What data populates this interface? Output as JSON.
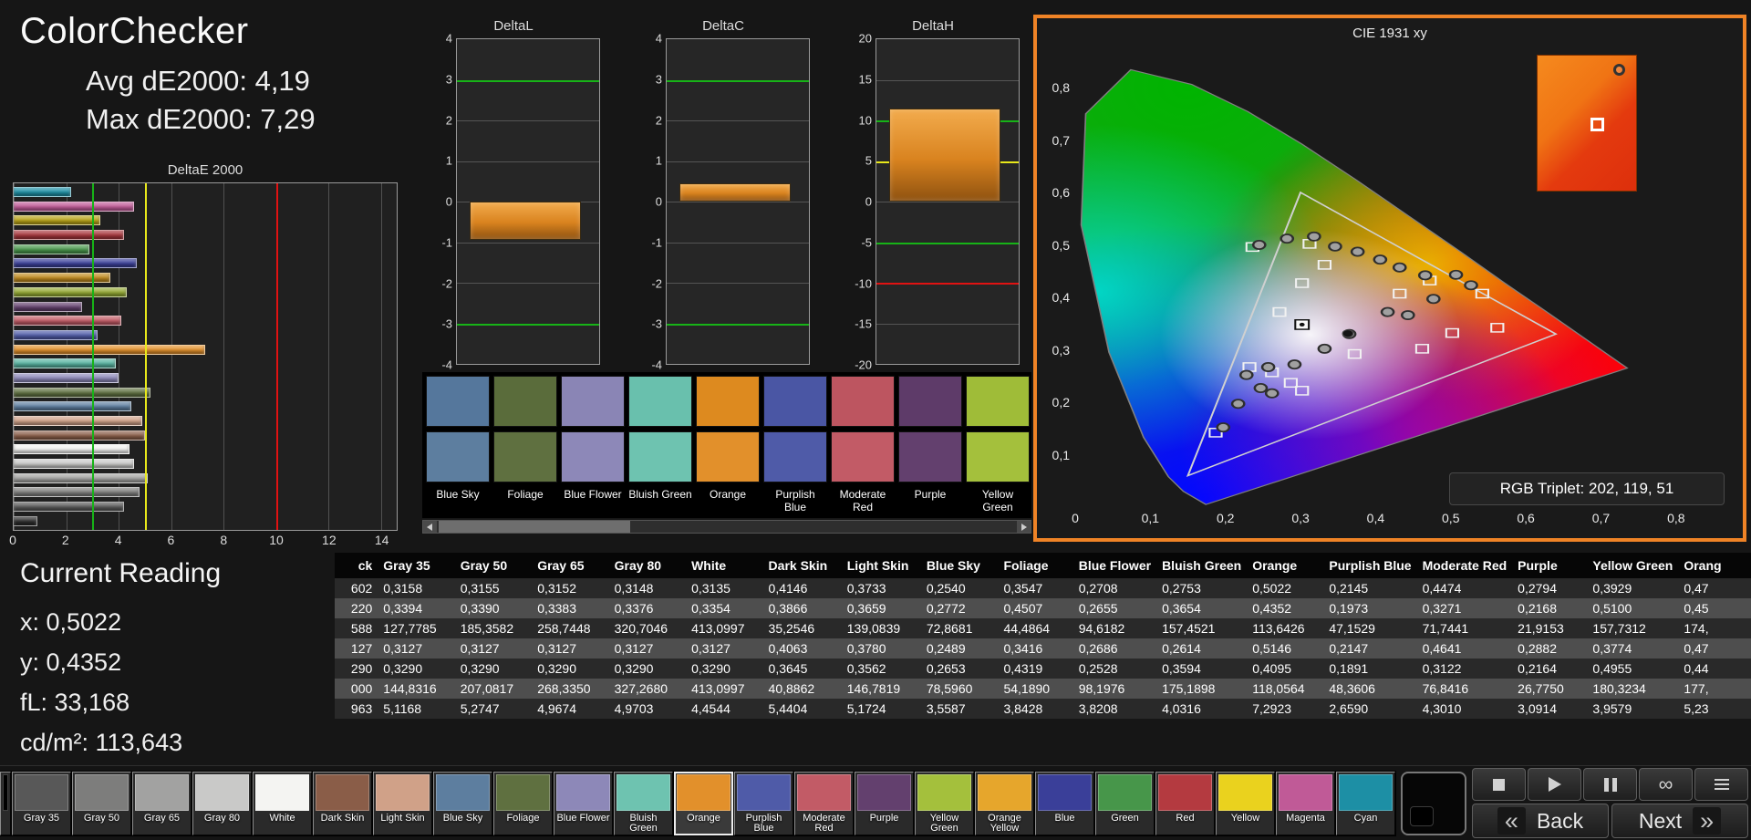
{
  "header": {
    "title": "ColorChecker",
    "avg": "Avg dE2000: 4,19",
    "max": "Max dE2000: 7,29"
  },
  "deltae_chart": {
    "title": "DeltaE 2000",
    "x_ticks": [
      0,
      2,
      4,
      6,
      8,
      10,
      12,
      14
    ],
    "x_max": 14.6,
    "thresholds": [
      {
        "value": 3,
        "color": "#17b317"
      },
      {
        "value": 5,
        "color": "#e8e81a"
      },
      {
        "value": 10,
        "color": "#e01212"
      }
    ],
    "bars": [
      {
        "name": "Cyan",
        "value": 2.2,
        "color": "#1d8fa5"
      },
      {
        "name": "Magenta",
        "value": 4.6,
        "color": "#c05a97"
      },
      {
        "name": "Yellow",
        "value": 3.3,
        "color": "#b8a216"
      },
      {
        "name": "Red",
        "value": 4.2,
        "color": "#a8363c"
      },
      {
        "name": "Green",
        "value": 2.9,
        "color": "#47964a"
      },
      {
        "name": "Blue",
        "value": 4.7,
        "color": "#3a3f99"
      },
      {
        "name": "Orange Yellow",
        "value": 3.7,
        "color": "#c08a1e"
      },
      {
        "name": "Yellow Green",
        "value": 4.3,
        "color": "#93a832"
      },
      {
        "name": "Purple",
        "value": 2.6,
        "color": "#63406e"
      },
      {
        "name": "Moderate Red",
        "value": 4.1,
        "color": "#c25b66"
      },
      {
        "name": "Purplish Blue",
        "value": 3.2,
        "color": "#4f5ba8"
      },
      {
        "name": "Orange",
        "value": 7.29,
        "color": "#e2902b"
      },
      {
        "name": "Bluish Green",
        "value": 3.9,
        "color": "#57b3a0"
      },
      {
        "name": "Blue Flower",
        "value": 4.0,
        "color": "#8d88b8"
      },
      {
        "name": "Foliage",
        "value": 5.2,
        "color": "#5f7040"
      },
      {
        "name": "Blue Sky",
        "value": 4.5,
        "color": "#5d7e9f"
      },
      {
        "name": "Light Skin",
        "value": 4.9,
        "color": "#d0a188"
      },
      {
        "name": "Dark Skin",
        "value": 5.0,
        "color": "#8a5d48"
      },
      {
        "name": "White",
        "value": 4.4,
        "color": "#f2f2f0"
      },
      {
        "name": "Gray 80",
        "value": 4.6,
        "color": "#c9c9c8"
      },
      {
        "name": "Gray 65",
        "value": 5.1,
        "color": "#a2a2a1"
      },
      {
        "name": "Gray 50",
        "value": 4.8,
        "color": "#7d7d7c"
      },
      {
        "name": "Gray 35",
        "value": 4.2,
        "color": "#585858"
      },
      {
        "name": "Black",
        "value": 0.9,
        "color": "#2a2a2a"
      }
    ]
  },
  "delta_charts": [
    {
      "title": "DeltaL",
      "min": -4,
      "max": 4,
      "tick_step": 1,
      "bar_from": 0,
      "bar_to": -0.95,
      "ref_lines": [
        {
          "value": 3,
          "color": "#17b317"
        },
        {
          "value": -3,
          "color": "#17b317"
        }
      ]
    },
    {
      "title": "DeltaC",
      "min": -4,
      "max": 4,
      "tick_step": 1,
      "bar_from": 0,
      "bar_to": 0.45,
      "ref_lines": [
        {
          "value": 3,
          "color": "#17b317"
        },
        {
          "value": -3,
          "color": "#17b317"
        }
      ]
    },
    {
      "title": "DeltaH",
      "min": -20,
      "max": 20,
      "tick_step": 5,
      "bar_from": 0,
      "bar_to": 11.5,
      "ref_lines": [
        {
          "value": 10,
          "color": "#17b317"
        },
        {
          "value": 5,
          "color": "#e8e81a"
        },
        {
          "value": -5,
          "color": "#17b317"
        },
        {
          "value": -10,
          "color": "#e01212"
        }
      ]
    }
  ],
  "swatch_strip": {
    "columns": [
      {
        "label": "Blue Sky",
        "top": "#55779c",
        "bottom": "#5d7e9f"
      },
      {
        "label": "Foliage",
        "top": "#5a6c3b",
        "bottom": "#5f7040"
      },
      {
        "label": "Blue Flower",
        "top": "#8a85b5",
        "bottom": "#8d88b8"
      },
      {
        "label": "Bluish Green",
        "top": "#69c0ad",
        "bottom": "#6ec3b0"
      },
      {
        "label": "Orange",
        "top": "#dd8a1f",
        "bottom": "#e2902b"
      },
      {
        "label": "Purplish Blue",
        "top": "#4a56a4",
        "bottom": "#4f5ba8"
      },
      {
        "label": "Moderate Red",
        "top": "#bd5560",
        "bottom": "#c25b66"
      },
      {
        "label": "Purple",
        "top": "#5e3b69",
        "bottom": "#63406e"
      },
      {
        "label": "Yellow Green",
        "top": "#9fbc38",
        "bottom": "#a4c03c"
      }
    ]
  },
  "cie": {
    "title": "CIE 1931 xy",
    "rgb_label": "RGB Triplet: 202, 119, 51",
    "x_ticks": [
      "0",
      "0,1",
      "0,2",
      "0,3",
      "0,4",
      "0,5",
      "0,6",
      "0,7",
      "0,8"
    ],
    "y_ticks": [
      "0,8",
      "0,7",
      "0,6",
      "0,5",
      "0,4",
      "0,3",
      "0,2",
      "0,1"
    ],
    "gamut_triangle": [
      [
        0.64,
        0.33
      ],
      [
        0.3,
        0.6
      ],
      [
        0.15,
        0.06
      ]
    ],
    "measured_points": [
      [
        0.245,
        0.5
      ],
      [
        0.282,
        0.512
      ],
      [
        0.318,
        0.516
      ],
      [
        0.346,
        0.497
      ],
      [
        0.376,
        0.487
      ],
      [
        0.406,
        0.472
      ],
      [
        0.432,
        0.457
      ],
      [
        0.466,
        0.442
      ],
      [
        0.507,
        0.443
      ],
      [
        0.527,
        0.423
      ],
      [
        0.477,
        0.397
      ],
      [
        0.443,
        0.366
      ],
      [
        0.416,
        0.372
      ],
      [
        0.365,
        0.33
      ],
      [
        0.332,
        0.302
      ],
      [
        0.292,
        0.272
      ],
      [
        0.257,
        0.267
      ],
      [
        0.228,
        0.252
      ],
      [
        0.247,
        0.227
      ],
      [
        0.217,
        0.197
      ],
      [
        0.262,
        0.217
      ],
      [
        0.197,
        0.152
      ]
    ],
    "reference_points": [
      [
        0.236,
        0.496
      ],
      [
        0.312,
        0.502
      ],
      [
        0.332,
        0.462
      ],
      [
        0.302,
        0.427
      ],
      [
        0.272,
        0.372
      ],
      [
        0.232,
        0.267
      ],
      [
        0.262,
        0.257
      ],
      [
        0.287,
        0.237
      ],
      [
        0.302,
        0.222
      ],
      [
        0.187,
        0.142
      ],
      [
        0.432,
        0.407
      ],
      [
        0.472,
        0.432
      ],
      [
        0.542,
        0.407
      ],
      [
        0.562,
        0.342
      ],
      [
        0.502,
        0.332
      ],
      [
        0.462,
        0.302
      ],
      [
        0.372,
        0.292
      ]
    ],
    "highlight_point": [
      0.302,
      0.348
    ],
    "solid_point": [
      0.363,
      0.331
    ]
  },
  "current_reading": {
    "title": "Current Reading",
    "x": "x: 0,5022",
    "y": "y: 0,4352",
    "fl": "fL: 33,168",
    "cdm2": "cd/m²: 113,643"
  },
  "table": {
    "headers": [
      "ck",
      "Gray 35",
      "Gray 50",
      "Gray 65",
      "Gray 80",
      "White",
      "Dark Skin",
      "Light Skin",
      "Blue Sky",
      "Foliage",
      "Blue Flower",
      "Bluish Green",
      "Orange",
      "Purplish Blue",
      "Moderate Red",
      "Purple",
      "Yellow Green",
      "Orang"
    ],
    "rows": [
      [
        "602",
        "0,3158",
        "0,3155",
        "0,3152",
        "0,3148",
        "0,3135",
        "0,4146",
        "0,3733",
        "0,2540",
        "0,3547",
        "0,2708",
        "0,2753",
        "0,5022",
        "0,2145",
        "0,4474",
        "0,2794",
        "0,3929",
        "0,47"
      ],
      [
        "220",
        "0,3394",
        "0,3390",
        "0,3383",
        "0,3376",
        "0,3354",
        "0,3866",
        "0,3659",
        "0,2772",
        "0,4507",
        "0,2655",
        "0,3654",
        "0,4352",
        "0,1973",
        "0,3271",
        "0,2168",
        "0,5100",
        "0,45"
      ],
      [
        "588",
        "127,7785",
        "185,3582",
        "258,7448",
        "320,7046",
        "413,0997",
        "35,2546",
        "139,0839",
        "72,8681",
        "44,4864",
        "94,6182",
        "157,4521",
        "113,6426",
        "47,1529",
        "71,7441",
        "21,9153",
        "157,7312",
        "174,"
      ],
      [
        "127",
        "0,3127",
        "0,3127",
        "0,3127",
        "0,3127",
        "0,3127",
        "0,4063",
        "0,3780",
        "0,2489",
        "0,3416",
        "0,2686",
        "0,2614",
        "0,5146",
        "0,2147",
        "0,4641",
        "0,2882",
        "0,3774",
        "0,47"
      ],
      [
        "290",
        "0,3290",
        "0,3290",
        "0,3290",
        "0,3290",
        "0,3290",
        "0,3645",
        "0,3562",
        "0,2653",
        "0,4319",
        "0,2528",
        "0,3594",
        "0,4095",
        "0,1891",
        "0,3122",
        "0,2164",
        "0,4955",
        "0,44"
      ],
      [
        "000",
        "144,8316",
        "207,0817",
        "268,3350",
        "327,2680",
        "413,0997",
        "40,8862",
        "146,7819",
        "78,5960",
        "54,1890",
        "98,1976",
        "175,1898",
        "118,0564",
        "48,3606",
        "76,8416",
        "26,7750",
        "180,3234",
        "177,"
      ],
      [
        "963",
        "5,1168",
        "5,2747",
        "4,9674",
        "4,9703",
        "4,4544",
        "5,4404",
        "5,1724",
        "3,5587",
        "3,8428",
        "3,8208",
        "4,0316",
        "7,2923",
        "2,6590",
        "4,3010",
        "3,0914",
        "3,9579",
        "5,23"
      ]
    ]
  },
  "toolbar": {
    "patches": [
      {
        "label": "",
        "color": "#000000",
        "partial": true
      },
      {
        "label": "Gray 35",
        "color": "#585858"
      },
      {
        "label": "Gray 50",
        "color": "#7d7d7c"
      },
      {
        "label": "Gray 65",
        "color": "#a2a2a1"
      },
      {
        "label": "Gray 80",
        "color": "#c9c9c8"
      },
      {
        "label": "White",
        "color": "#f4f4f2"
      },
      {
        "label": "Dark Skin",
        "color": "#8a5d48"
      },
      {
        "label": "Light Skin",
        "color": "#d0a188"
      },
      {
        "label": "Blue Sky",
        "color": "#5d7e9f"
      },
      {
        "label": "Foliage",
        "color": "#5f7040"
      },
      {
        "label": "Blue Flower",
        "color": "#8d88b8"
      },
      {
        "label": "Bluish Green",
        "color": "#6ec3b0"
      },
      {
        "label": "Orange",
        "color": "#e2902b",
        "selected": true
      },
      {
        "label": "Purplish Blue",
        "color": "#4f5ba8"
      },
      {
        "label": "Moderate Red",
        "color": "#c25b66"
      },
      {
        "label": "Purple",
        "color": "#63406e"
      },
      {
        "label": "Yellow Green",
        "color": "#a4c03c"
      },
      {
        "label": "Orange Yellow",
        "color": "#e6a62c"
      },
      {
        "label": "Blue",
        "color": "#3a3f99"
      },
      {
        "label": "Green",
        "color": "#47964a"
      },
      {
        "label": "Red",
        "color": "#b43a40"
      },
      {
        "label": "Yellow",
        "color": "#ead21e"
      },
      {
        "label": "Magenta",
        "color": "#c05a97"
      },
      {
        "label": "Cyan",
        "color": "#1d8fa5"
      }
    ]
  },
  "controls": {
    "media_buttons": [
      "stop-icon",
      "play-icon",
      "pause-icon",
      "infinity-icon",
      "list-icon"
    ],
    "back": "Back",
    "next": "Next",
    "back_arrow": "«",
    "next_arrow": "»"
  }
}
